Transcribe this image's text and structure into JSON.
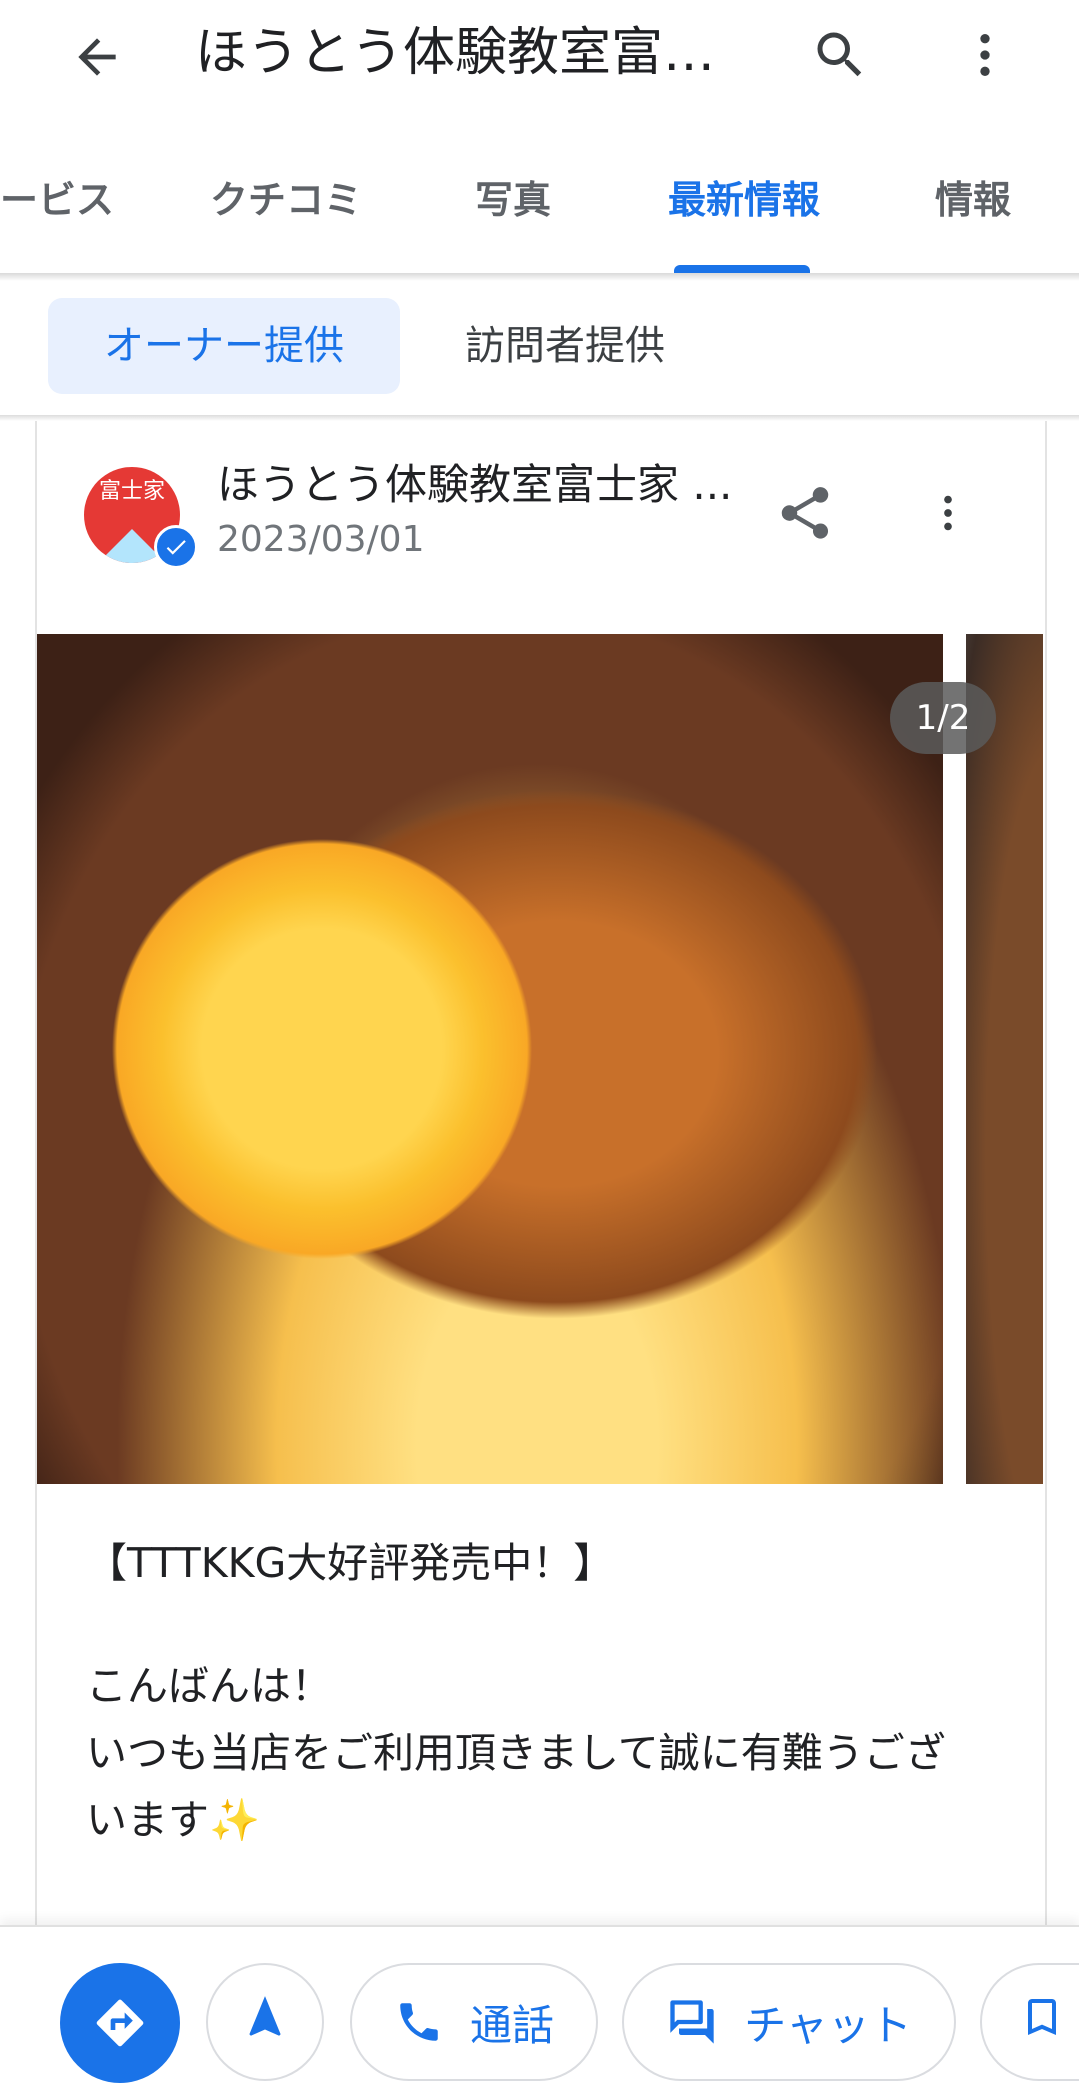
{
  "header": {
    "title": "ほうとう体験教室富…"
  },
  "tabs": [
    {
      "label": "ービス"
    },
    {
      "label": "クチコミ"
    },
    {
      "label": "写真"
    },
    {
      "label": "最新情報",
      "active": true
    },
    {
      "label": "情報"
    }
  ],
  "filters": {
    "owner_label": "オーナー提供",
    "visitor_label": "訪問者提供"
  },
  "post": {
    "avatar_text": "富士家",
    "author": "ほうとう体験教室富士家 ...",
    "date": "2023/03/01",
    "photo_counter": "1/2",
    "headline": "【TTTKKG大好評発売中！】",
    "greeting": "こんばんは！",
    "line1": "いつも当店をご利用頂きまして誠に有難うござ",
    "line2": "います✨"
  },
  "actions": {
    "call_label": "通話",
    "chat_label": "チャット"
  },
  "colors": {
    "accent": "#1a73e8",
    "chip_bg": "#e8f0fe"
  }
}
